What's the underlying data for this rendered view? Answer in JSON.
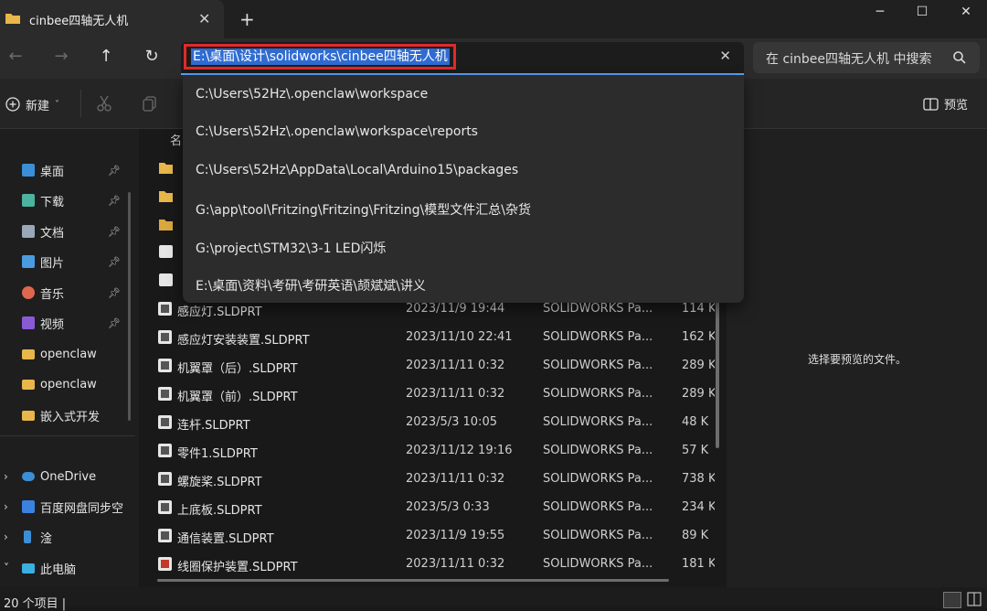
{
  "window": {
    "tab_title": "cinbee四轴无人机",
    "tab_close": "✕",
    "new_tab": "+",
    "minimize": "─",
    "maximize": "☐",
    "close": "✕"
  },
  "nav": {
    "back": "←",
    "forward": "→",
    "up": "↑",
    "refresh": "↻"
  },
  "address": {
    "value": "E:\\桌面\\设计\\solidworks\\cinbee四轴无人机",
    "clear": "✕"
  },
  "search": {
    "placeholder": "在 cinbee四轴无人机 中搜索"
  },
  "toolbar": {
    "new_label": "新建",
    "new_caret": "˅",
    "preview_label": "预览"
  },
  "address_suggestions": [
    "C:\\Users\\52Hz\\.openclaw\\workspace",
    "C:\\Users\\52Hz\\.openclaw\\workspace\\reports",
    "C:\\Users\\52Hz\\AppData\\Local\\Arduino15\\packages",
    "G:\\app\\tool\\Fritzing\\Fritzing\\Fritzing\\模型文件汇总\\杂货",
    "G:\\project\\STM32\\3-1 LED闪烁",
    "E:\\桌面\\资料\\考研\\考研英语\\颉斌斌\\讲义"
  ],
  "sidebar": {
    "pinned": [
      {
        "label": "桌面",
        "icon": "desktop-icon",
        "color": "#3a8fd6"
      },
      {
        "label": "下载",
        "icon": "download-icon",
        "color": "#4cb3a0"
      },
      {
        "label": "文档",
        "icon": "document-icon",
        "color": "#9aa7b8"
      },
      {
        "label": "图片",
        "icon": "picture-icon",
        "color": "#4a9be0"
      },
      {
        "label": "音乐",
        "icon": "music-icon",
        "color": "#e0674f"
      },
      {
        "label": "视频",
        "icon": "video-icon",
        "color": "#8a5ad6"
      }
    ],
    "folders": [
      {
        "label": "openclaw"
      },
      {
        "label": "openclaw"
      },
      {
        "label": "嵌入式开发"
      }
    ],
    "roots": [
      {
        "label": "OneDrive",
        "chevron": "›",
        "icon": "onedrive-icon",
        "color": "#3a8fd6"
      },
      {
        "label": "百度网盘同步空",
        "chevron": "›",
        "icon": "cloud-drive-icon",
        "color": "#3b82e0"
      },
      {
        "label": "淦",
        "chevron": "›",
        "icon": "drive-icon",
        "color": "#3a8fd6"
      },
      {
        "label": "此电脑",
        "chevron": "˅",
        "icon": "computer-icon",
        "color": "#3ab0e0"
      }
    ]
  },
  "file_list": {
    "column_name": "名",
    "files": [
      {
        "name": "感应灯.SLDPRT",
        "date": "2023/11/9 19:44",
        "type": "SOLIDWORKS Pa...",
        "size": "114 K"
      },
      {
        "name": "感应灯安装装置.SLDPRT",
        "date": "2023/11/10 22:41",
        "type": "SOLIDWORKS Pa...",
        "size": "162 K"
      },
      {
        "name": "机翼罩（后）.SLDPRT",
        "date": "2023/11/11 0:32",
        "type": "SOLIDWORKS Pa...",
        "size": "289 K"
      },
      {
        "name": "机翼罩（前）.SLDPRT",
        "date": "2023/11/11 0:32",
        "type": "SOLIDWORKS Pa...",
        "size": "289 K"
      },
      {
        "name": "连杆.SLDPRT",
        "date": "2023/5/3 10:05",
        "type": "SOLIDWORKS Pa...",
        "size": "48 K"
      },
      {
        "name": "零件1.SLDPRT",
        "date": "2023/11/12 19:16",
        "type": "SOLIDWORKS Pa...",
        "size": "57 K"
      },
      {
        "name": "螺旋桨.SLDPRT",
        "date": "2023/11/11 0:32",
        "type": "SOLIDWORKS Pa...",
        "size": "738 K"
      },
      {
        "name": "上底板.SLDPRT",
        "date": "2023/5/3 0:33",
        "type": "SOLIDWORKS Pa...",
        "size": "234 K"
      },
      {
        "name": "通信装置.SLDPRT",
        "date": "2023/11/9 19:55",
        "type": "SOLIDWORKS Pa...",
        "size": "89 K"
      },
      {
        "name": "线圈保护装置.SLDPRT",
        "date": "2023/11/11 0:32",
        "type": "SOLIDWORKS Pa...",
        "size": "181 K"
      }
    ]
  },
  "preview": {
    "message": "选择要预览的文件。"
  },
  "status": {
    "item_count": "20 个项目  |"
  },
  "colors": {
    "accent": "#2f6bd1",
    "highlight_border": "#e02a2a",
    "folder": "#e8b64a"
  }
}
